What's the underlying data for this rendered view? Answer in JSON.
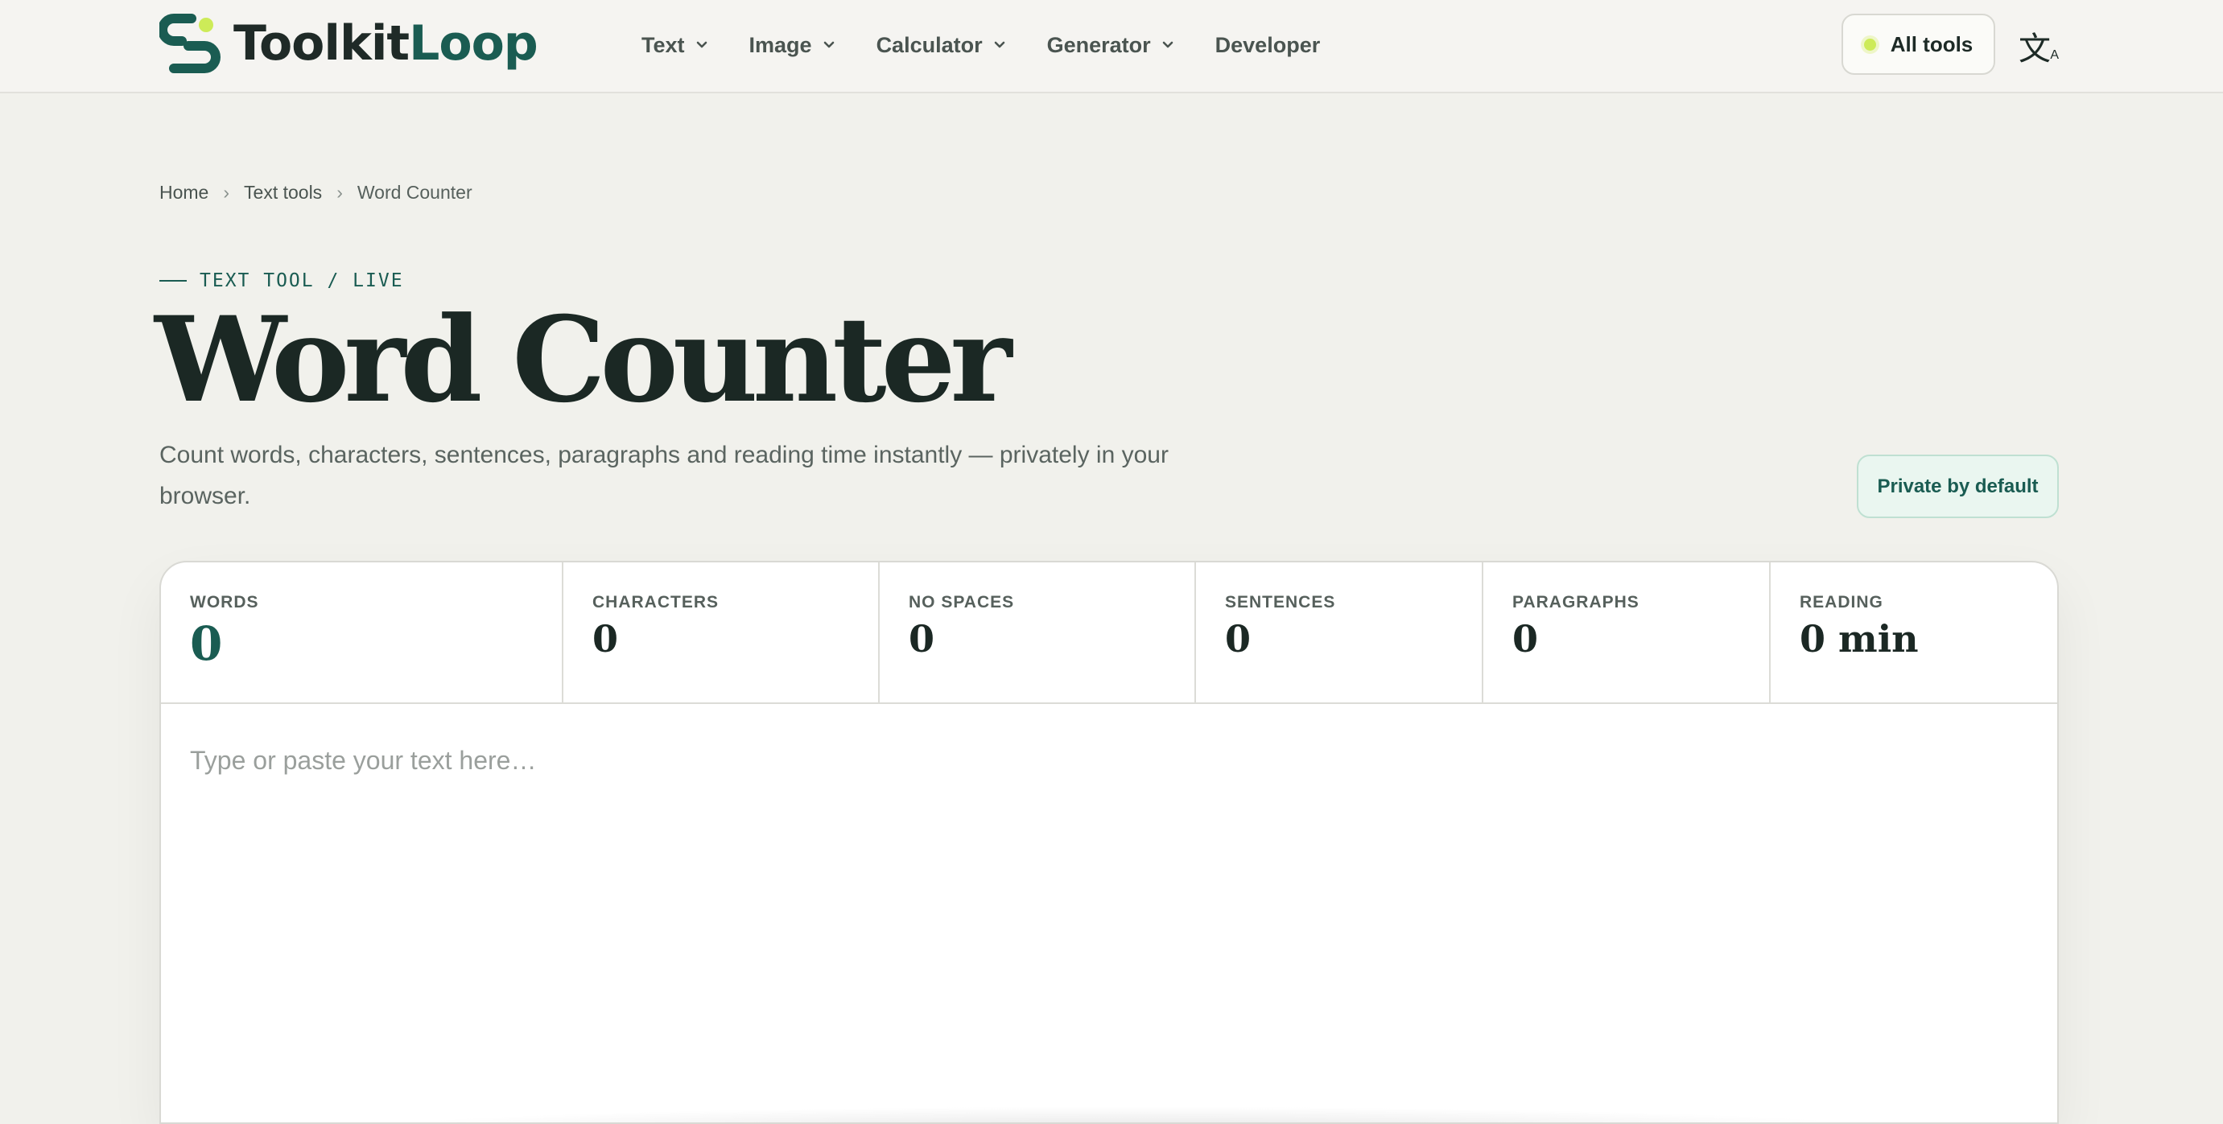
{
  "brand": {
    "name_part1": "Toolkit",
    "name_part2": "Loop",
    "colors": {
      "primary": "#1a5c52",
      "accent": "#cdeb58",
      "ink": "#1b2824"
    }
  },
  "nav": {
    "items": [
      {
        "label": "Text",
        "has_dropdown": true
      },
      {
        "label": "Image",
        "has_dropdown": true
      },
      {
        "label": "Calculator",
        "has_dropdown": true
      },
      {
        "label": "Generator",
        "has_dropdown": true
      },
      {
        "label": "Developer",
        "has_dropdown": false
      }
    ],
    "all_tools_label": "All tools",
    "language_icon": "translate-icon",
    "language_glyph": "文",
    "language_glyph_sub": "A"
  },
  "breadcrumb": {
    "items": [
      "Home",
      "Text tools",
      "Word Counter"
    ],
    "separator": "›"
  },
  "hero": {
    "kicker": "TEXT TOOL / LIVE",
    "title": "Word Counter",
    "subtitle": "Count words, characters, sentences, paragraphs and reading time instantly — privately in your browser.",
    "badge": "Private by default"
  },
  "stats": [
    {
      "label": "WORDS",
      "value": "0"
    },
    {
      "label": "CHARACTERS",
      "value": "0"
    },
    {
      "label": "NO SPACES",
      "value": "0"
    },
    {
      "label": "SENTENCES",
      "value": "0"
    },
    {
      "label": "PARAGRAPHS",
      "value": "0"
    },
    {
      "label": "READING",
      "value": "0 min"
    }
  ],
  "editor": {
    "placeholder": "Type or paste your text here…",
    "value": ""
  }
}
